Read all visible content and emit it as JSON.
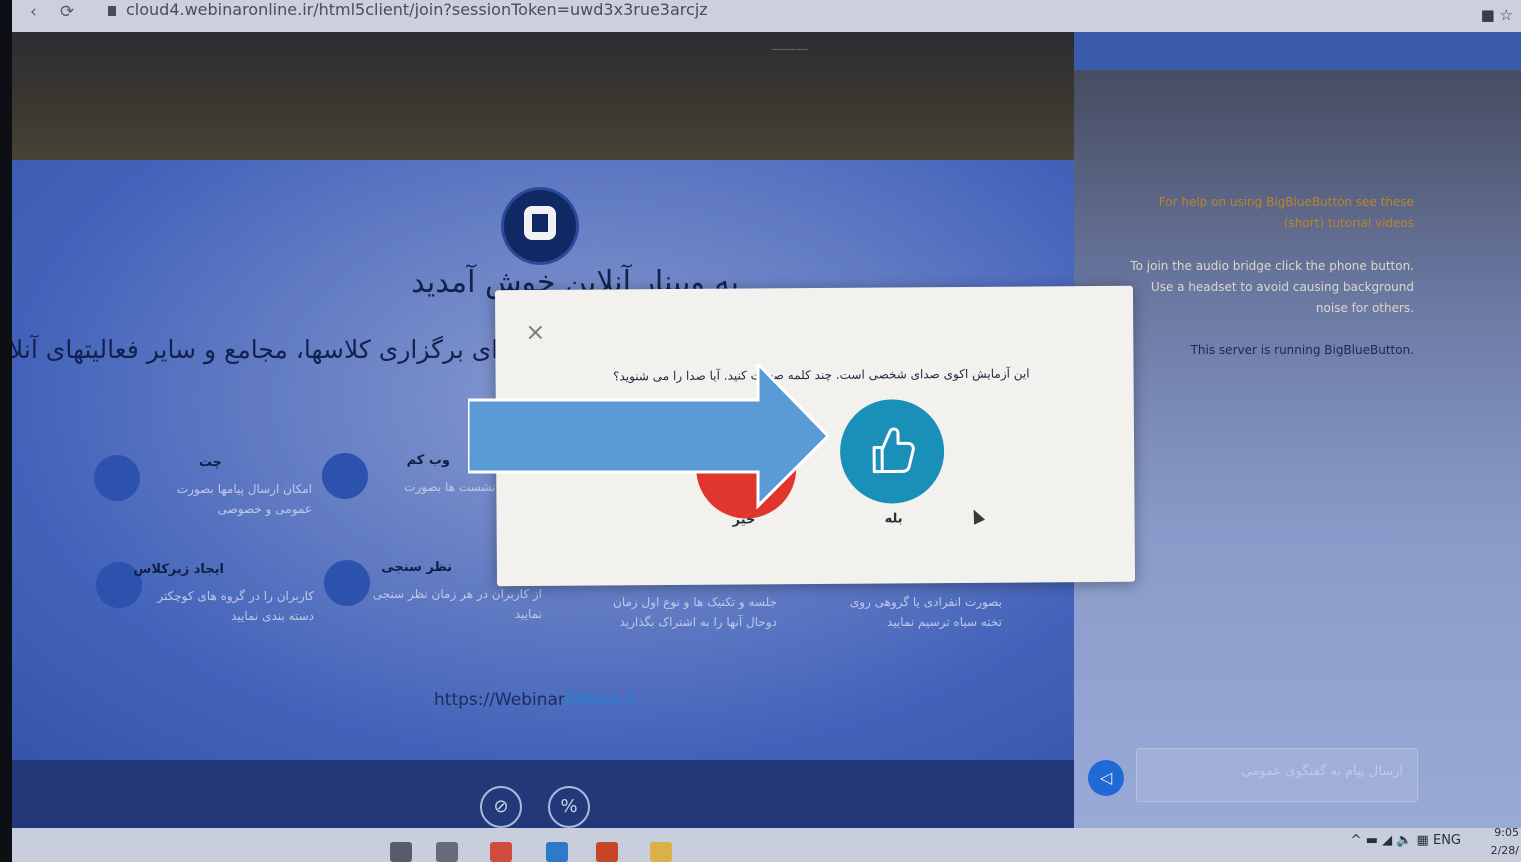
{
  "browser": {
    "back": "‹",
    "reload": "⟳",
    "url": "cloud4.webinaronline.ir/html5client/join?sessionToken=uwd3x3rue3arcjz",
    "icons": "■ ☆"
  },
  "header": {
    "title": "———"
  },
  "main": {
    "welcome": "به وبینار آنلاین خوش آمدید",
    "subtitle": "برای برگزاری کلاسها، مجامع و سایر فعالیتهای آنلاین.",
    "features": [
      {
        "title": "چت",
        "desc": "امکان ارسال پیامها بصورت عمومی و خصوصی"
      },
      {
        "title": "وب کم",
        "desc": "برگزاری نشست ها بصورت تصویری"
      },
      {
        "title": "ایجاد زیرکلاس",
        "desc": "کاربران را در گروه های کوچکتر دسته بندی نمایید"
      },
      {
        "title": "نظر سنجی",
        "desc": "از کاربران در هر زمان نظر سنجی نمایید"
      },
      {
        "title": "",
        "desc": "جلسه و تکنیک ها و نوع اول زمان دوحال آنها را به اشتراک بگذارید"
      },
      {
        "title": "",
        "desc": "بصورت انفرادی یا گروهی روی تخته سیاه ترسیم نمایید"
      }
    ],
    "site_url_prefix": "https://Webinar",
    "site_url_accent": "Online.ir"
  },
  "controls": {
    "video_icon": "⊘",
    "share_icon": "%"
  },
  "chat": {
    "lines": [
      "For help on using BigBlueButton see these",
      "(short) tutorial videos",
      "To join the audio bridge click the phone button.",
      "Use a headset to avoid causing background",
      "noise for others.",
      "This server is running BigBlueButton."
    ],
    "input_placeholder": "ارسال پیام به گفتگوی عمومی",
    "send_icon": "◁"
  },
  "modal": {
    "close": "×",
    "question": "این آزمایش اکوی صدای شخصی است. چند کلمه صحبت کنید. آیا صدا را می شنوید؟",
    "yes_label": "بله",
    "no_label": "خیر"
  },
  "taskbar": {
    "tray": "^ ▬ ◢ 🔈 ▦ ENG",
    "time": "9:05",
    "date": "2/28/"
  }
}
